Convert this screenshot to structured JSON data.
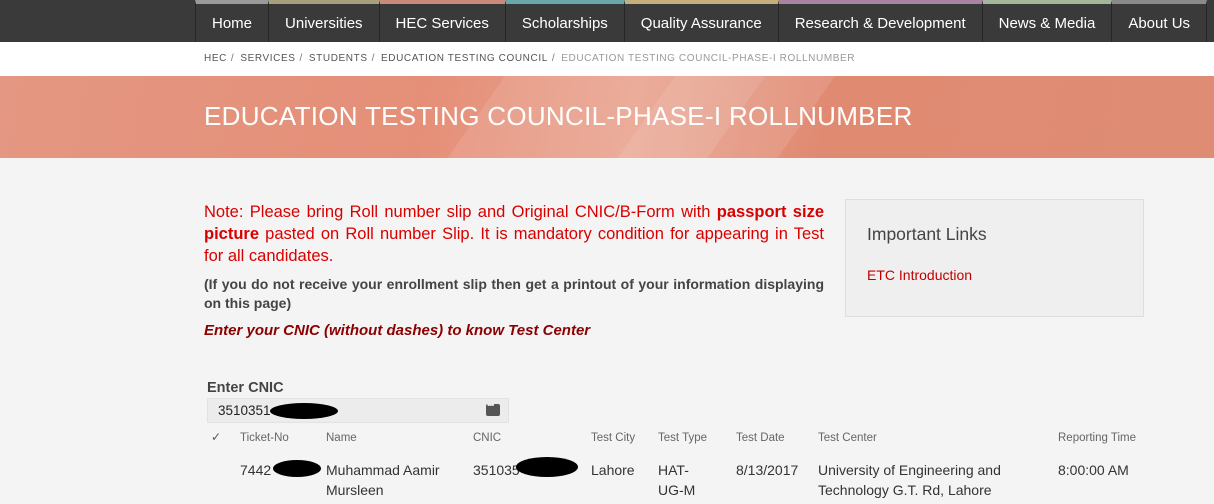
{
  "nav": {
    "items": [
      {
        "label": "Home",
        "accent": "#9a9a9a"
      },
      {
        "label": "Universities",
        "accent": "#a7a07e"
      },
      {
        "label": "HEC Services",
        "accent": "#c98a7c"
      },
      {
        "label": "Scholarships",
        "accent": "#6aa7a8"
      },
      {
        "label": "Quality Assurance",
        "accent": "#c3ae7c"
      },
      {
        "label": "Research & Development",
        "accent": "#a884a2"
      },
      {
        "label": "News & Media",
        "accent": "#a5b59a"
      },
      {
        "label": "About Us",
        "accent": "#8a8a8a"
      }
    ]
  },
  "breadcrumb": {
    "items": [
      "HEC",
      "SERVICES",
      "STUDENTS",
      "EDUCATION TESTING COUNCIL"
    ],
    "current": "EDUCATION TESTING COUNCIL-PHASE-I ROLLNUMBER",
    "separator": "/"
  },
  "banner": {
    "title": "EDUCATION TESTING COUNCIL-PHASE-I ROLLNUMBER"
  },
  "note": {
    "part1": "Note: Please bring Roll number slip and Original CNIC/B-Form with ",
    "bold": "passport size picture",
    "part2": " pasted on Roll number Slip. It is mandatory condition for appearing in Test for all candidates."
  },
  "subnote": "(If you do not receive your enrollment slip then get a printout of your information displaying on this page)",
  "prompt": "Enter your CNIC (without dashes) to know Test Center",
  "sidebar": {
    "title": "Important Links",
    "link": "ETC Introduction"
  },
  "form": {
    "label": "Enter CNIC",
    "value": "3510351"
  },
  "table": {
    "check": "✓",
    "headers": [
      "Ticket-No",
      "Name",
      "CNIC",
      "Test City",
      "Test Type",
      "Test Date",
      "Test Center",
      "Reporting Time"
    ],
    "row": {
      "ticket": "7442",
      "name": "Muhammad Aamir Mursleen",
      "cnic": "351035",
      "city": "Lahore",
      "type": "HAT-UG-M",
      "date": "8/13/2017",
      "center": "University of Engineering and Technology G.T. Rd, Lahore",
      "time": "8:00:00 AM"
    }
  }
}
